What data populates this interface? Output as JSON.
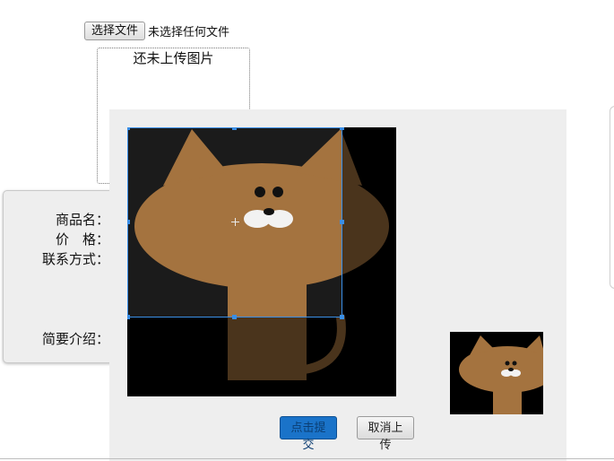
{
  "upload": {
    "choose_file_label": "选择文件",
    "no_file_text": "未选择任何文件",
    "preview_placeholder": "还未上传图片"
  },
  "form": {
    "labels": [
      "商品名：",
      "价　格：",
      "联系方式：",
      "简要介绍："
    ]
  },
  "cropper": {
    "submit_label": "点击提交",
    "cancel_label": "取消上传",
    "accent_color": "#3a8ee6",
    "submit_color": "#1a73c9",
    "image_description_icon": "brown-cat-icon"
  }
}
